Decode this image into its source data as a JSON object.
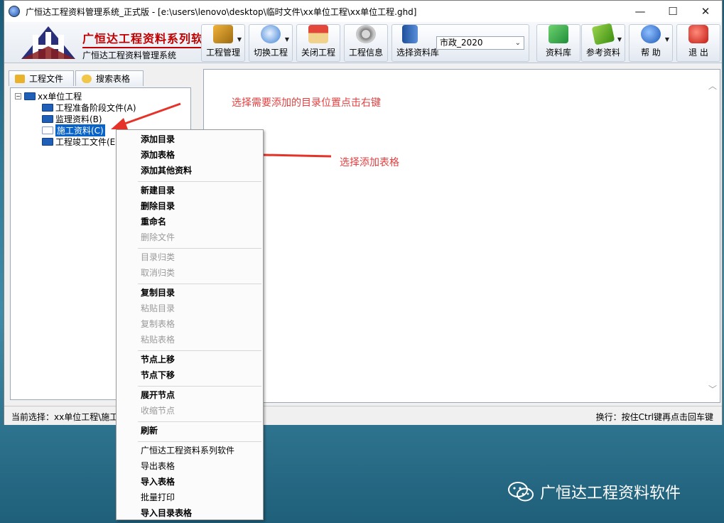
{
  "window": {
    "title": "广恒达工程资料管理系统_正式版 - [e:\\users\\lenovo\\desktop\\临时文件\\xx单位工程\\xx单位工程.ghd]"
  },
  "brand": {
    "title": "广恒达工程资料系列软件",
    "subtitle": "广恒达工程资料管理系统"
  },
  "toolbar": {
    "project_manage": "工程管理",
    "switch_project": "切换工程",
    "close_project": "关闭工程",
    "project_info": "工程信息",
    "select_library": "选择资料库",
    "library_selected": "市政_2020",
    "library": "资料库",
    "reference": "参考资料",
    "help": "帮 助",
    "exit": "退 出"
  },
  "tabs": {
    "project_files": "工程文件",
    "search_forms": "搜索表格"
  },
  "tree": {
    "root": "xx单位工程",
    "items": [
      "工程准备阶段文件(A)",
      "监理资料(B)",
      "施工资料(C)",
      "工程竣工文件(E"
    ]
  },
  "annotations": {
    "note1": "选择需要添加的目录位置点击右键",
    "note2": "选择添加表格"
  },
  "status": {
    "left": "当前选择：xx单位工程\\施工",
    "right": "换行：按住Ctrl键再点击回车键"
  },
  "menu": {
    "items": [
      "添加目录",
      "添加表格",
      "添加其他资料",
      "新建目录",
      "删除目录",
      "重命名",
      "删除文件",
      "目录归类",
      "取消归类",
      "复制目录",
      "粘贴目录",
      "复制表格",
      "粘贴表格",
      "节点上移",
      "节点下移",
      "展开节点",
      "收缩节点",
      "刷新",
      "广恒达工程资料系列软件",
      "导出表格",
      "导入表格",
      "批量打印",
      "导入目录表格"
    ]
  },
  "watermark": {
    "text": "广恒达工程资料软件"
  },
  "colors": {
    "accent_red": "#c00000",
    "annotation_red": "#e04040",
    "selection_blue": "#0a64c8",
    "desktop": "#2f7a97"
  },
  "icons": {
    "window_controls": [
      "—",
      "☐",
      "✕"
    ]
  }
}
